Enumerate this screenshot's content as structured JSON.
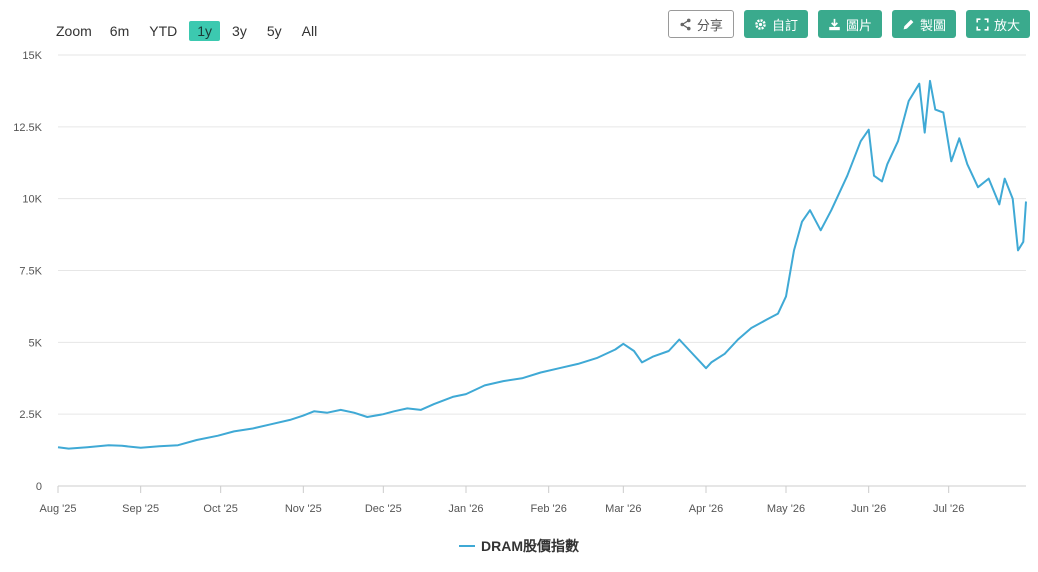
{
  "zoom": {
    "label": "Zoom",
    "options": [
      "6m",
      "YTD",
      "1y",
      "3y",
      "5y",
      "All"
    ],
    "active": "1y"
  },
  "toolbar": {
    "share": "分享",
    "custom": "自訂",
    "image": "圖片",
    "draw": "製圖",
    "fullscreen": "放大"
  },
  "colors": {
    "series": "#3fa9d5",
    "accent": "#3aaa8d",
    "zoom_active": "#3cc9b0",
    "grid": "#e6e6e6"
  },
  "chart_data": {
    "type": "line",
    "title": "",
    "xlabel": "",
    "ylabel": "",
    "ylim": [
      0,
      15000
    ],
    "yticks": [
      0,
      2500,
      5000,
      7500,
      10000,
      12500,
      15000
    ],
    "ytick_labels": [
      "0",
      "2.5K",
      "5K",
      "7.5K",
      "10K",
      "12.5K",
      "15K"
    ],
    "xlim": [
      "2025-08-01",
      "2026-07-30"
    ],
    "xticks": [
      "2025-08-01",
      "2025-09-01",
      "2025-10-01",
      "2025-11-01",
      "2025-12-01",
      "2026-01-01",
      "2026-02-01",
      "2026-03-01",
      "2026-04-01",
      "2026-05-01",
      "2026-06-01",
      "2026-07-01"
    ],
    "xtick_labels": [
      "Aug '25",
      "Sep '25",
      "Oct '25",
      "Nov '25",
      "Dec '25",
      "Jan '26",
      "Feb '26",
      "Mar '26",
      "Apr '26",
      "May '26",
      "Jun '26",
      "Jul '26"
    ],
    "grid": true,
    "legend": "bottom-center",
    "series": [
      {
        "name": "DRAM股價指數",
        "points": [
          [
            "2025-08-01",
            1350
          ],
          [
            "2025-08-05",
            1300
          ],
          [
            "2025-08-12",
            1350
          ],
          [
            "2025-08-20",
            1420
          ],
          [
            "2025-08-25",
            1400
          ],
          [
            "2025-09-01",
            1330
          ],
          [
            "2025-09-08",
            1380
          ],
          [
            "2025-09-15",
            1420
          ],
          [
            "2025-09-22",
            1600
          ],
          [
            "2025-09-30",
            1750
          ],
          [
            "2025-10-06",
            1900
          ],
          [
            "2025-10-13",
            2000
          ],
          [
            "2025-10-20",
            2150
          ],
          [
            "2025-10-27",
            2300
          ],
          [
            "2025-11-01",
            2450
          ],
          [
            "2025-11-05",
            2600
          ],
          [
            "2025-11-10",
            2550
          ],
          [
            "2025-11-15",
            2650
          ],
          [
            "2025-11-20",
            2550
          ],
          [
            "2025-11-25",
            2400
          ],
          [
            "2025-12-01",
            2500
          ],
          [
            "2025-12-05",
            2600
          ],
          [
            "2025-12-10",
            2700
          ],
          [
            "2025-12-15",
            2650
          ],
          [
            "2025-12-20",
            2850
          ],
          [
            "2025-12-27",
            3100
          ],
          [
            "2026-01-01",
            3200
          ],
          [
            "2026-01-08",
            3500
          ],
          [
            "2026-01-15",
            3650
          ],
          [
            "2026-01-22",
            3750
          ],
          [
            "2026-01-29",
            3950
          ],
          [
            "2026-02-05",
            4100
          ],
          [
            "2026-02-12",
            4250
          ],
          [
            "2026-02-19",
            4450
          ],
          [
            "2026-02-26",
            4750
          ],
          [
            "2026-03-01",
            4950
          ],
          [
            "2026-03-05",
            4700
          ],
          [
            "2026-03-08",
            4300
          ],
          [
            "2026-03-12",
            4500
          ],
          [
            "2026-03-18",
            4700
          ],
          [
            "2026-03-22",
            5100
          ],
          [
            "2026-03-26",
            4700
          ],
          [
            "2026-03-30",
            4300
          ],
          [
            "2026-04-01",
            4100
          ],
          [
            "2026-04-03",
            4300
          ],
          [
            "2026-04-08",
            4600
          ],
          [
            "2026-04-13",
            5100
          ],
          [
            "2026-04-18",
            5500
          ],
          [
            "2026-04-24",
            5800
          ],
          [
            "2026-04-28",
            6000
          ],
          [
            "2026-05-01",
            6600
          ],
          [
            "2026-05-04",
            8200
          ],
          [
            "2026-05-07",
            9200
          ],
          [
            "2026-05-10",
            9600
          ],
          [
            "2026-05-14",
            8900
          ],
          [
            "2026-05-18",
            9600
          ],
          [
            "2026-05-24",
            10800
          ],
          [
            "2026-05-29",
            12000
          ],
          [
            "2026-06-01",
            12400
          ],
          [
            "2026-06-03",
            10800
          ],
          [
            "2026-06-06",
            10600
          ],
          [
            "2026-06-08",
            11200
          ],
          [
            "2026-06-12",
            12000
          ],
          [
            "2026-06-16",
            13400
          ],
          [
            "2026-06-20",
            14000
          ],
          [
            "2026-06-22",
            12300
          ],
          [
            "2026-06-24",
            14100
          ],
          [
            "2026-06-26",
            13100
          ],
          [
            "2026-06-29",
            13000
          ],
          [
            "2026-07-02",
            11300
          ],
          [
            "2026-07-05",
            12100
          ],
          [
            "2026-07-08",
            11200
          ],
          [
            "2026-07-12",
            10400
          ],
          [
            "2026-07-16",
            10700
          ],
          [
            "2026-07-20",
            9800
          ],
          [
            "2026-07-22",
            10700
          ],
          [
            "2026-07-25",
            10000
          ],
          [
            "2026-07-27",
            8200
          ],
          [
            "2026-07-29",
            8500
          ],
          [
            "2026-07-30",
            9900
          ]
        ]
      }
    ]
  }
}
